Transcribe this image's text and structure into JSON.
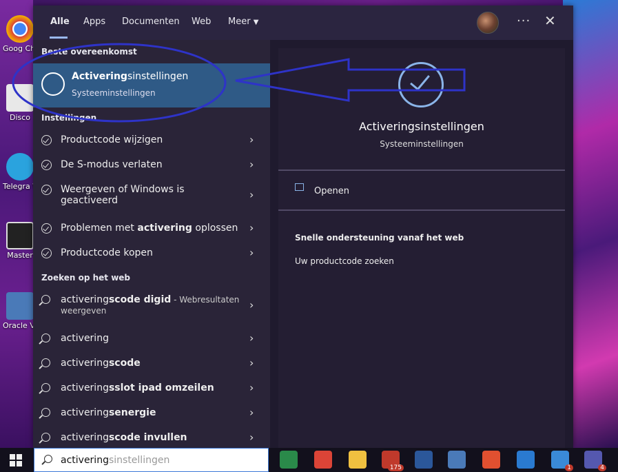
{
  "desktop": {
    "icons": [
      {
        "label": "Goog Chro",
        "icon": "chrome-icon",
        "color": "#4285f4"
      },
      {
        "label": "Disco",
        "icon": "document-icon",
        "color": "#e8e8e8"
      },
      {
        "label": "Telegra Web",
        "icon": "telegram-icon",
        "color": "#2aa3de"
      },
      {
        "label": "Master",
        "icon": "masterplan-icon",
        "color": "#222"
      },
      {
        "label": "Oracle VirtualB",
        "icon": "virtualbox-icon",
        "color": "#4a7ab8"
      }
    ]
  },
  "search_panel": {
    "tabs": [
      "Alle",
      "Apps",
      "Documenten",
      "Web",
      "Meer"
    ],
    "active_tab": "Alle",
    "best_match": {
      "heading": "Beste overeenkomst",
      "title_bold": "Activering",
      "title_rest": "sinstellingen",
      "subtitle": "Systeeminstellingen"
    },
    "settings": {
      "heading": "Instellingen",
      "items": [
        {
          "pre": "Productcode wijzigen",
          "bold": "",
          "post": ""
        },
        {
          "pre": "De S-modus verlaten",
          "bold": "",
          "post": ""
        },
        {
          "pre": "Weergeven of Windows is",
          "bold": "",
          "post": "",
          "line2": "geactiveerd"
        },
        {
          "pre": "Problemen met ",
          "bold": "activering",
          "post": " oplossen"
        },
        {
          "pre": "Productcode kopen",
          "bold": "",
          "post": ""
        }
      ]
    },
    "web": {
      "heading": "Zoeken op het web",
      "items": [
        {
          "pre": "activering",
          "bold": "scode digid",
          "sub": " - Webresultaten",
          "line2": "weergeven"
        },
        {
          "pre": "activering",
          "bold": "",
          "sub": ""
        },
        {
          "pre": "activering",
          "bold": "scode",
          "sub": ""
        },
        {
          "pre": "activering",
          "bold": "sslot ipad omzeilen",
          "sub": ""
        },
        {
          "pre": "activering",
          "bold": "senergie",
          "sub": ""
        },
        {
          "pre": "activering",
          "bold": "scode invullen",
          "sub": ""
        }
      ]
    },
    "preview": {
      "title": "Activeringsinstellingen",
      "subtitle": "Systeeminstellingen",
      "open_label": "Openen",
      "web_heading": "Snelle ondersteuning vanaf het web",
      "web_link": "Uw productcode zoeken"
    }
  },
  "taskbar": {
    "search_typed": "activering",
    "search_suggest": "sinstellingen",
    "apps": [
      {
        "icon": "parrot-icon",
        "color": "#2a8a4a"
      },
      {
        "icon": "chrome-icon",
        "color": "#db4437"
      },
      {
        "icon": "file-explorer-icon",
        "color": "#f0c040"
      },
      {
        "icon": "calendar-app-icon",
        "color": "#c0392b",
        "badge": "175"
      },
      {
        "icon": "word-icon",
        "color": "#2b579a"
      },
      {
        "icon": "virtualbox-icon",
        "color": "#4a7ab8"
      },
      {
        "icon": "snipping-tool-icon",
        "color": "#e05030"
      },
      {
        "icon": "photos-icon",
        "color": "#2a7ad0"
      },
      {
        "icon": "mail-icon",
        "color": "#3a8ad8",
        "badge": "1"
      },
      {
        "icon": "teams-icon",
        "color": "#5558af",
        "badge": "4"
      }
    ]
  },
  "annotation_color": "#2e33c8"
}
